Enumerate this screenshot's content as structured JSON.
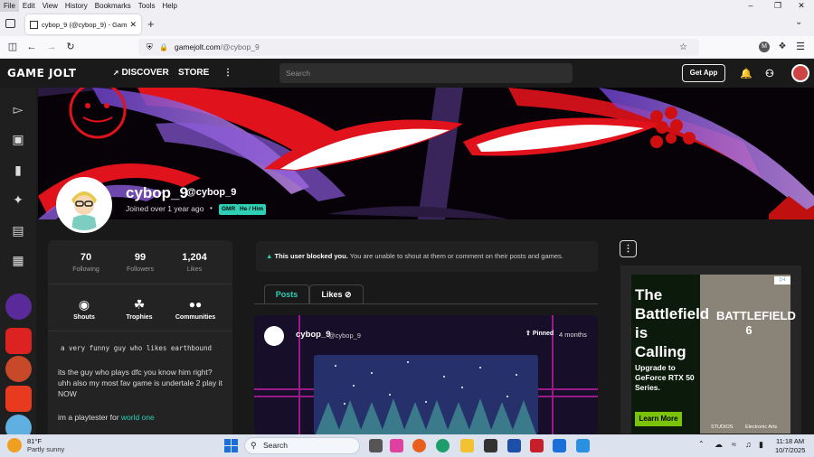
{
  "browser": {
    "menu": [
      "File",
      "Edit",
      "View",
      "History",
      "Bookmarks",
      "Tools",
      "Help"
    ],
    "tab_title": "cybop_9 (@cybop_9) - Game Jolt",
    "url_host": "gamejolt.com",
    "url_path": "/@cybop_9",
    "icons": [
      "back-icon",
      "forward-icon",
      "reload-icon",
      "shield-icon",
      "lock-icon",
      "bookmark-star-icon",
      "extensions-icon",
      "menu-icon"
    ]
  },
  "gj": {
    "logo": "GAME JOLT",
    "nav_discover": "DISCOVER",
    "nav_store": "STORE",
    "search_placeholder": "Search",
    "get_app": "Get App"
  },
  "profile": {
    "name": "cybop_9",
    "handle": "@cybop_9",
    "joined": "Joined over 1 year ago",
    "tags": [
      "GMR",
      "He / Him"
    ],
    "stats": [
      {
        "value": "70",
        "label": "Following"
      },
      {
        "value": "99",
        "label": "Followers"
      },
      {
        "value": "1,204",
        "label": "Likes"
      }
    ],
    "buttons": [
      "Shouts",
      "Trophies",
      "Communities"
    ],
    "bio_title": "a very funny guy who likes earthbound",
    "bio_p1": "its the guy who plays dfc you know him right? uhh also my most fav game is undertale 2 play it NOW",
    "bio_p2_prefix": "im a playtester for ",
    "bio_p2_link": "world one"
  },
  "blocked": {
    "bold": "This user blocked you.",
    "rest": " You are unable to shout at them or comment on their posts and games."
  },
  "tabs": [
    "Posts",
    "Likes"
  ],
  "post": {
    "author": "cybop_9",
    "handle": "@cybop_9",
    "pinned": "Pinned",
    "time": "4 months"
  },
  "ad": {
    "headline": "The Battlefield is Calling",
    "sub": "Upgrade to GeForce RTX 50 Series.",
    "cta": "Learn More",
    "product": "BATTLEFIELD 6",
    "brand1": "STUDIOS",
    "brand2": "Electronic Arts"
  },
  "taskbar": {
    "temp": "81°F",
    "weather": "Partly sunny",
    "search": "Search",
    "time": "11:18 AM",
    "date": "10/7/2025"
  },
  "colors": {
    "accent": "#2ecfb4",
    "banner_red": "#e0121b",
    "banner_purple": "#8a5ad8"
  }
}
